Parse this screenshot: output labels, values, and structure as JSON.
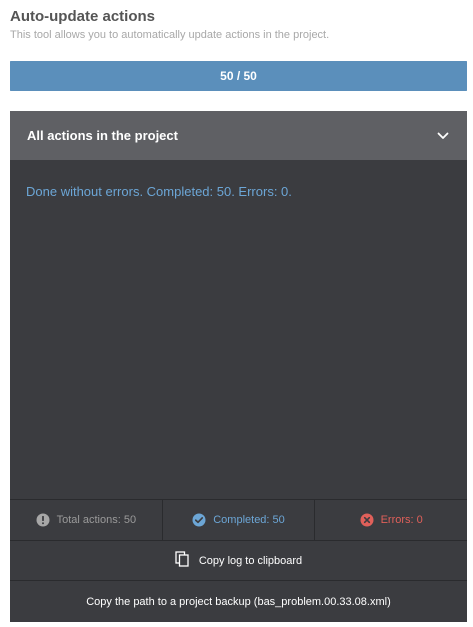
{
  "header": {
    "title": "Auto-update actions",
    "subtitle": "This tool allows you to automatically update actions in the project."
  },
  "progress": {
    "label": "50 / 50",
    "fraction": 1.0,
    "color": "#5b8fbb"
  },
  "dropdown": {
    "label": "All actions in the project",
    "icon": "chevron-down-icon"
  },
  "log": {
    "message": "Done without errors. Completed: 50. Errors: 0."
  },
  "stats": {
    "total": {
      "label": "Total actions: 50",
      "icon": "exclamation-circle-icon"
    },
    "completed": {
      "label": "Completed: 50",
      "icon": "check-circle-icon"
    },
    "errors": {
      "label": "Errors: 0",
      "icon": "x-circle-icon"
    }
  },
  "actions": {
    "copy_log": "Copy log to clipboard",
    "copy_path": "Copy the path to a project backup (bas_problem.00.33.08.xml)"
  },
  "colors": {
    "panel_bg": "#3b3c40",
    "dropdown_bg": "#5f6064",
    "accent_blue": "#6ca6d6",
    "error_red": "#e0605a"
  }
}
